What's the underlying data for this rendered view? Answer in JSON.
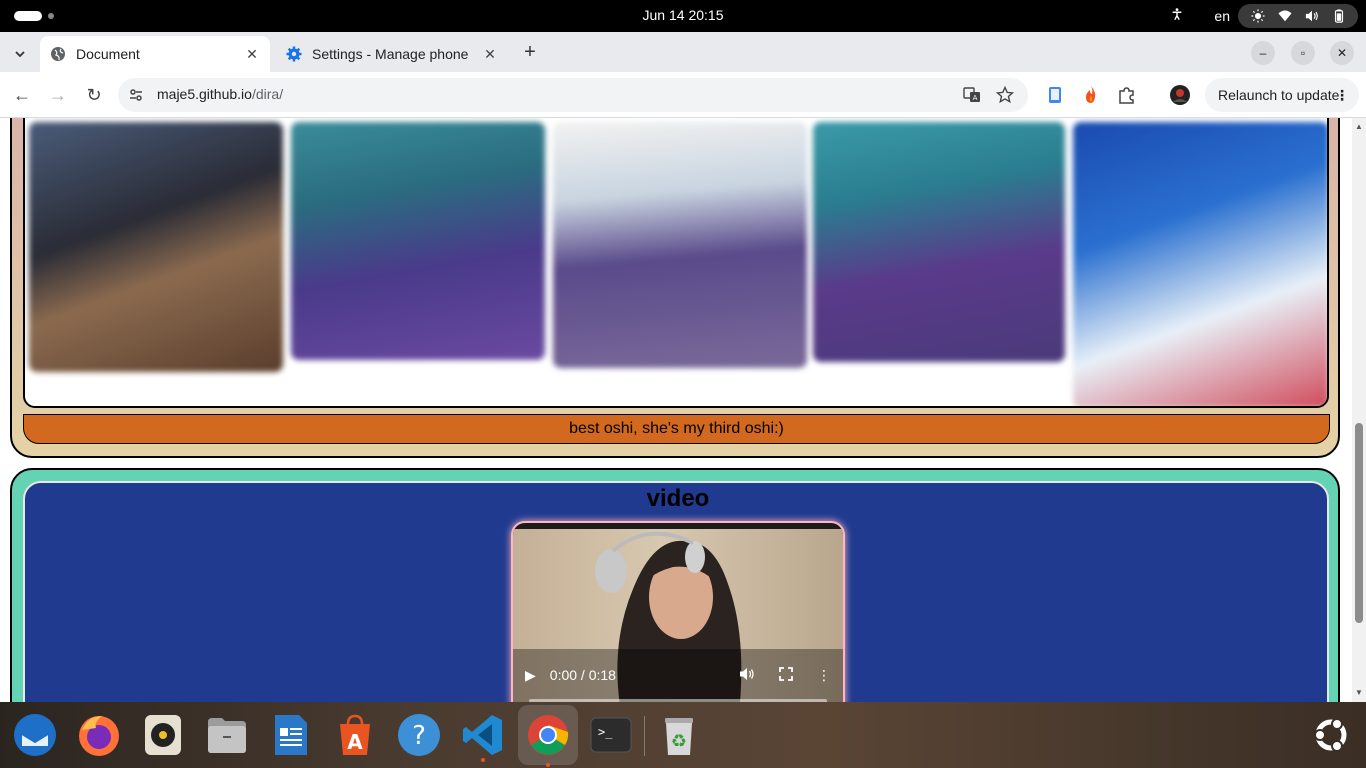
{
  "topbar": {
    "clock": "Jun 14  20:15",
    "keyboard_layout": "en"
  },
  "tabs": [
    {
      "title": "Document",
      "active": true
    },
    {
      "title": "Settings - Manage phone",
      "active": false
    }
  ],
  "toolbar": {
    "url_host": "maje5.github.io",
    "url_path": "/dira/",
    "relaunch_label": "Relaunch to update"
  },
  "page": {
    "gallery_caption": "best oshi, she's my third oshi:)",
    "video_heading": "video",
    "video": {
      "time": "0:00 / 0:18",
      "progress": 0
    }
  },
  "dock": {
    "apps": [
      "thunderbird",
      "firefox",
      "rhythmbox",
      "files",
      "libreoffice-writer",
      "app-center",
      "help",
      "vscode",
      "chrome",
      "terminal",
      "trash"
    ]
  },
  "colors": {
    "caption_bg": "#d2691e",
    "video_panel_bg": "#1f3a8f",
    "video_section_border": "#63d3b4",
    "gallery_section_bg": "#e4d3a6"
  }
}
